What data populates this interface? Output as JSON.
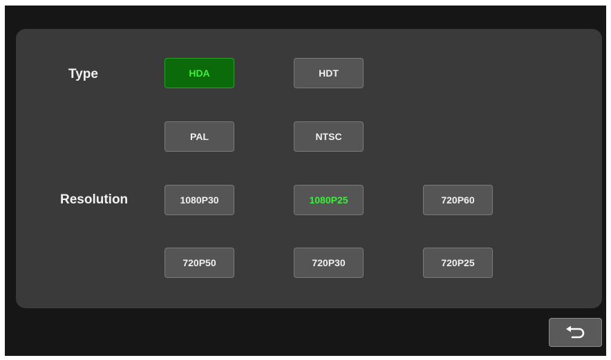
{
  "type_row": {
    "label": "Type",
    "buttons": [
      {
        "label": "HDA",
        "state": "selected"
      },
      {
        "label": "HDT",
        "state": "normal"
      },
      {
        "label": "PAL",
        "state": "normal"
      },
      {
        "label": "NTSC",
        "state": "normal"
      }
    ]
  },
  "resolution_row": {
    "label": "Resolution",
    "buttons": [
      {
        "label": "1080P30",
        "state": "normal"
      },
      {
        "label": "1080P25",
        "state": "selected"
      },
      {
        "label": "720P60",
        "state": "normal"
      },
      {
        "label": "720P50",
        "state": "normal"
      },
      {
        "label": "720P30",
        "state": "normal"
      },
      {
        "label": "720P25",
        "state": "normal"
      }
    ]
  },
  "back_button": {
    "icon": "back-arrow-icon"
  },
  "colors": {
    "background": "#161616",
    "panel": "#3a3a3a",
    "button": "#555555",
    "selected_fill": "#0b6b0b",
    "selected_text": "#3cf03c"
  }
}
